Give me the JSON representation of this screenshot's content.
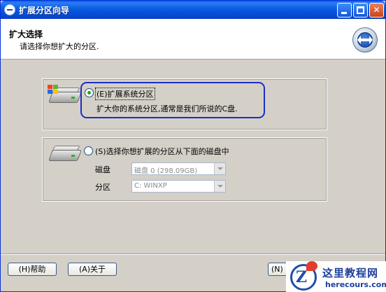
{
  "window": {
    "title": "扩展分区向导"
  },
  "header": {
    "title": "扩大选择",
    "subtitle": "请选择你想扩大的分区."
  },
  "option1": {
    "label": "(E)扩展系统分区",
    "description": "扩大你的系统分区,通常是我们所说的C盘.",
    "selected": true
  },
  "option2": {
    "label": "(S)选择你想扩展的分区从下面的磁盘中",
    "selected": false,
    "disk_label": "磁盘",
    "disk_value": "磁盘 0 (298.09GB)",
    "partition_label": "分区",
    "partition_value": "C: WINXP"
  },
  "buttons": {
    "help": "(H)帮助",
    "about": "(A)关于",
    "next": "(N)"
  },
  "watermark": {
    "logo_letter": "Z",
    "title": "这里教程网",
    "url": "herecours.com"
  },
  "colors": {
    "titlebar": "#0a5ce0",
    "highlight": "#1a2ec8"
  }
}
